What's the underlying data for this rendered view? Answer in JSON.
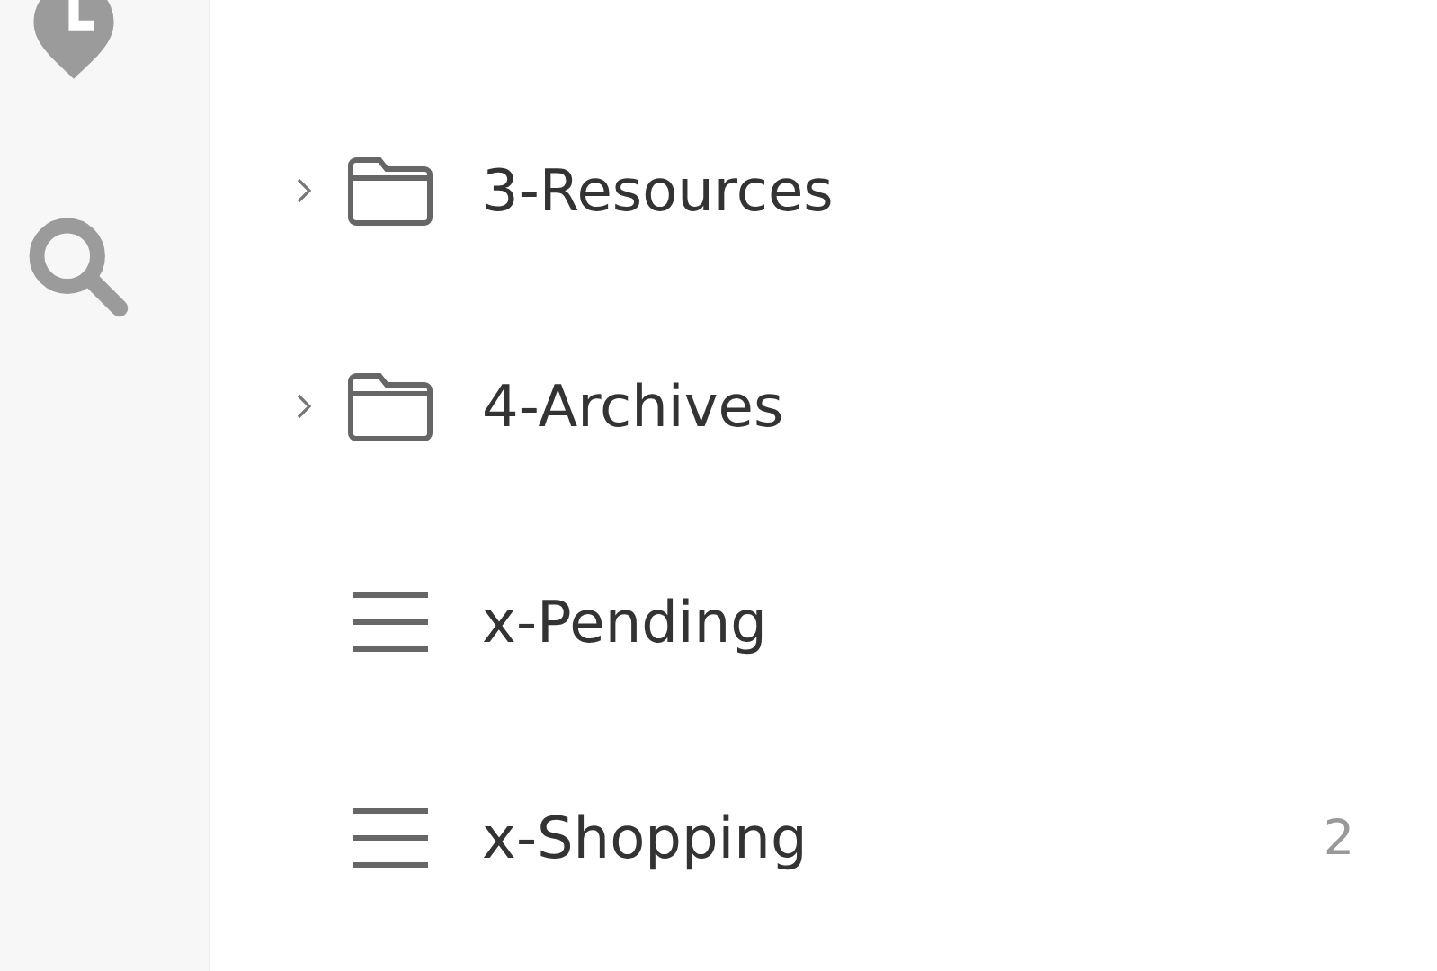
{
  "sidebar": {
    "icons": [
      {
        "kind": "history"
      },
      {
        "kind": "search"
      }
    ]
  },
  "tree": [
    {
      "label": "3-Resources",
      "kind": "folder",
      "expanded": false
    },
    {
      "label": "4-Archives",
      "kind": "folder",
      "expanded": false
    },
    {
      "label": "x-Pending",
      "kind": "list"
    },
    {
      "label": "x-Shopping",
      "kind": "list",
      "count": "2"
    }
  ]
}
